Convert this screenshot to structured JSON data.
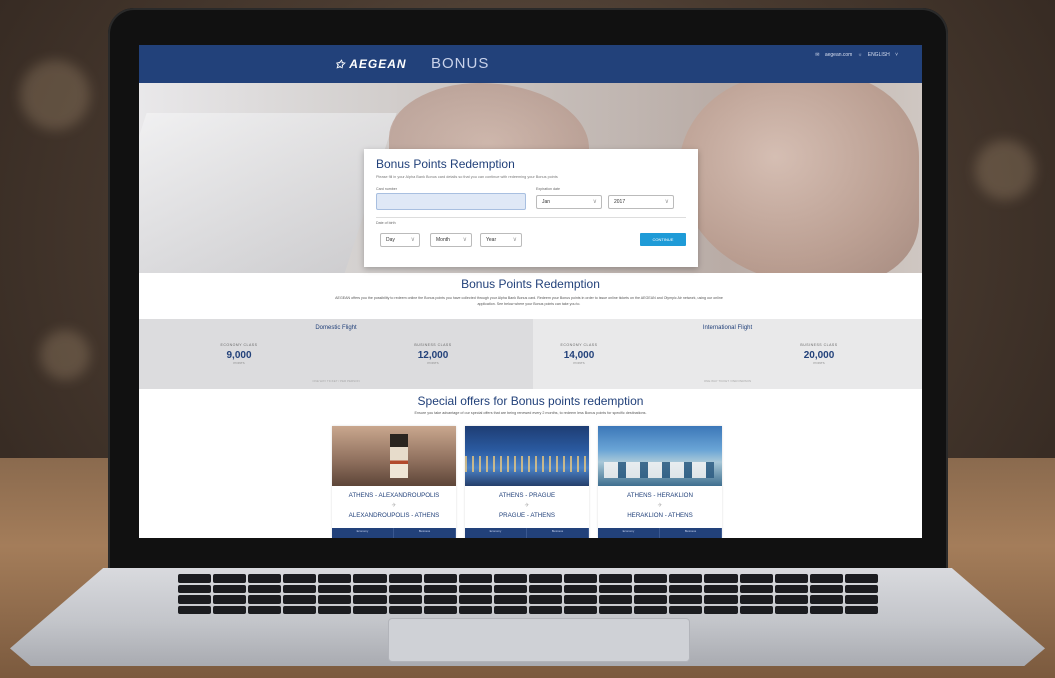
{
  "site": {
    "brand": "AEGEAN",
    "program": "BONUS",
    "account_email": "aegean.com",
    "language": "ENGLISH"
  },
  "form": {
    "title": "Bonus Points Redemption",
    "subtitle": "Please fill in your Alpha Bank Bonus card details so that you can continue with redeeming your Bonus points",
    "card_number_label": "Card number",
    "expiration_label": "Expiration date",
    "exp_month": "Jan",
    "exp_year": "2017",
    "dob_label": "Date of birth",
    "dob_day": "Day",
    "dob_month": "Month",
    "dob_year": "Year",
    "continue_label": "CONTINUE"
  },
  "intro": {
    "title": "Bonus Points Redemption",
    "text": "AEGEAN offers you the possibility to redeem online the Bonus points you have collected through your Alpha Bank Bonus card. Redeem your Bonus points in order to issue online tickets on the AEGEAN and Olympic Air network, using our online application. See below where your Bonus points can take you to."
  },
  "points": {
    "domestic": {
      "title": "Domestic Flight",
      "economy_label": "ECONOMY CLASS",
      "economy_value": "9,000",
      "business_label": "BUSINESS CLASS",
      "business_value": "12,000",
      "unit": "POINTS",
      "note": "ONE WAY TICKET / PER PERSON"
    },
    "international": {
      "title": "International Flight",
      "economy_label": "ECONOMY CLASS",
      "economy_value": "14,000",
      "business_label": "BUSINESS CLASS",
      "business_value": "20,000",
      "unit": "POINTS",
      "note": "ONE WAY TICKET / PER PERSON"
    }
  },
  "offers": {
    "title": "Special offers for Bonus points redemption",
    "subtitle": "Ensure you take advantage of our special offers that are being renewed every 2 months, to redeem less Bonus points for specific destinations.",
    "cards": [
      {
        "route_out": "ATHENS - ALEXANDROUPOLIS",
        "route_back": "ALEXANDROUPOLIS - ATHENS",
        "economy": "Economy",
        "business": "Business"
      },
      {
        "route_out": "ATHENS - PRAGUE",
        "route_back": "PRAGUE - ATHENS",
        "economy": "Economy",
        "business": "Business"
      },
      {
        "route_out": "ATHENS - HERAKLION",
        "route_back": "HERAKLION - ATHENS",
        "economy": "Economy",
        "business": "Business"
      }
    ]
  },
  "colors": {
    "brand_navy": "#22417a",
    "cta_blue": "#1f9bd7"
  }
}
